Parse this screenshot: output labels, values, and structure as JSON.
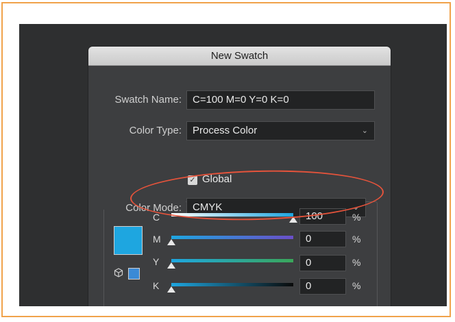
{
  "dialog": {
    "title": "New Swatch",
    "swatch_name_label": "Swatch Name:",
    "swatch_name_value": "C=100 M=0 Y=0 K=0",
    "color_type_label": "Color Type:",
    "color_type_value": "Process Color",
    "global_label": "Global",
    "global_checked": true,
    "color_mode_label": "Color Mode:",
    "color_mode_value": "CMYK"
  },
  "channels": [
    {
      "letter": "C",
      "value": "100",
      "unit": "%",
      "level": 1.0
    },
    {
      "letter": "M",
      "value": "0",
      "unit": "%",
      "level": 0.0
    },
    {
      "letter": "Y",
      "value": "0",
      "unit": "%",
      "level": 0.0
    },
    {
      "letter": "K",
      "value": "0",
      "unit": "%",
      "level": 0.0
    }
  ],
  "colors": {
    "frame_border": "#f0a24a",
    "swatch_cyan": "#1ea6e0",
    "annotation": "#e5533b"
  },
  "icons": {
    "dropdown": "chevron-down-icon",
    "checkbox": "checkmark-icon",
    "color_model": "cube-icon"
  }
}
